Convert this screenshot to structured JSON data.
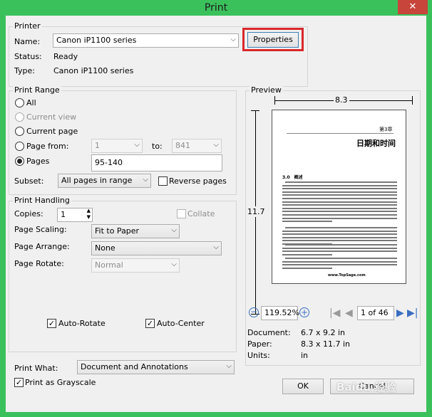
{
  "window": {
    "title": "Print",
    "close": "✕"
  },
  "printer": {
    "group_label": "Printer",
    "name_label": "Name:",
    "name_value": "Canon iP1100 series",
    "properties_label": "Properties",
    "status_label": "Status:",
    "status_value": "Ready",
    "type_label": "Type:",
    "type_value": "Canon iP1100 series"
  },
  "print_range": {
    "group_label": "Print Range",
    "all_label": "All",
    "current_view_label": "Current view",
    "current_page_label": "Current page",
    "page_from_label": "Page from:",
    "page_from_value": "1",
    "to_label": "to:",
    "to_value": "841",
    "pages_label": "Pages",
    "pages_value": "95-140",
    "subset_label": "Subset:",
    "subset_value": "All pages in range",
    "reverse_label": "Reverse pages"
  },
  "print_handling": {
    "group_label": "Print Handling",
    "copies_label": "Copies:",
    "copies_value": "1",
    "collate_label": "Collate",
    "scaling_label": "Page Scaling:",
    "scaling_value": "Fit to Paper",
    "arrange_label": "Page Arrange:",
    "arrange_value": "None",
    "rotate_label": "Page Rotate:",
    "rotate_value": "Normal",
    "auto_rotate_label": "Auto-Rotate",
    "auto_center_label": "Auto-Center"
  },
  "print_what": {
    "label": "Print What:",
    "value": "Document and Annotations",
    "grayscale_label": "Print as Grayscale"
  },
  "preview": {
    "group_label": "Preview",
    "width_dim": "8.3",
    "height_dim": "11.7",
    "page_chapter": "第3章",
    "page_title": "日期和时间",
    "page_section": "3.0　概述",
    "page_footer": "www.TopSage.com",
    "zoom_value": "119.52%",
    "page_indicator": "1 of 46",
    "document_label": "Document:",
    "document_value": "6.7 x 9.2 in",
    "paper_label": "Paper:",
    "paper_value": "8.3 x 11.7 in",
    "units_label": "Units:",
    "units_value": "in"
  },
  "buttons": {
    "ok": "OK",
    "cancel": "Cancel"
  },
  "watermark": "Baidu 经验",
  "highlight_color": "#d9282a",
  "accent_color": "#3bc15c"
}
